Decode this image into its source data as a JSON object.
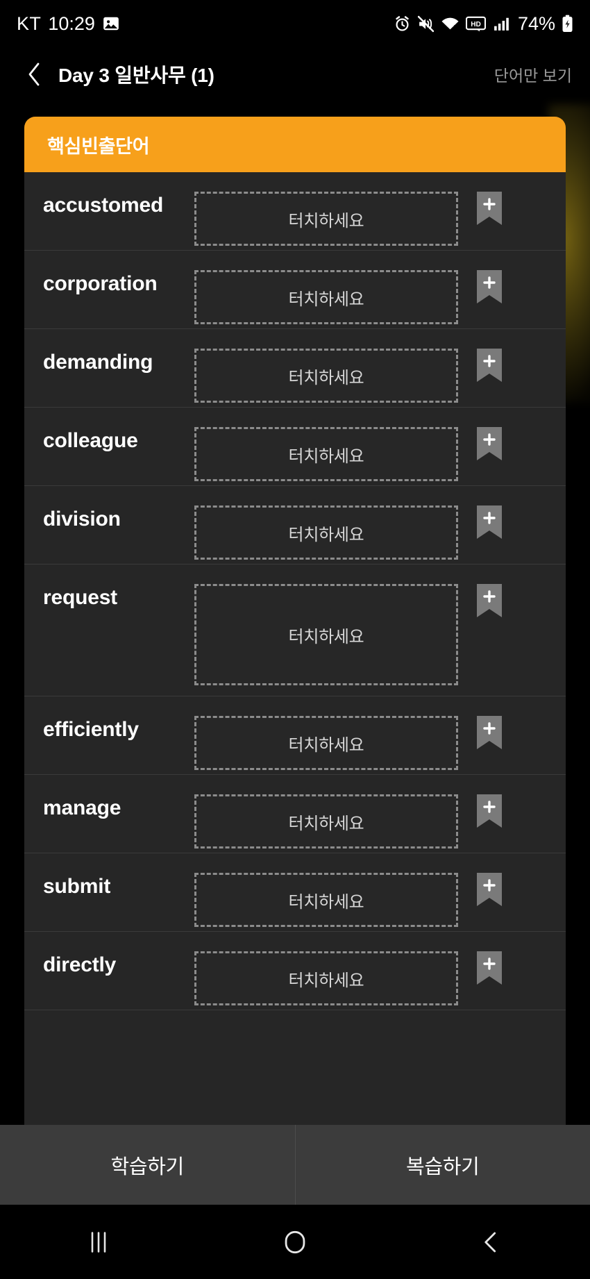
{
  "status_bar": {
    "carrier": "KT",
    "time": "10:29",
    "battery_percent": "74%",
    "icons": {
      "photo": "photo-icon",
      "alarm": "alarm-icon",
      "mute": "volume-mute-icon",
      "wifi": "wifi-icon",
      "hd": "hd-icon",
      "signal": "cellular-signal-icon",
      "battery": "battery-charging-icon"
    }
  },
  "header": {
    "back_label": "back-chevron",
    "title": "Day 3 일반사무 (1)",
    "action": "단어만 보기"
  },
  "card": {
    "banner_title": "핵심빈출단어",
    "banner_color": "#F7A01B",
    "touch_placeholder": "터치하세요",
    "bookmark_label": "+",
    "rows": [
      {
        "word": "accustomed",
        "reveal": "터치하세요",
        "tall": false
      },
      {
        "word": "corporation",
        "reveal": "터치하세요",
        "tall": false
      },
      {
        "word": "demanding",
        "reveal": "터치하세요",
        "tall": false
      },
      {
        "word": "colleague",
        "reveal": "터치하세요",
        "tall": false
      },
      {
        "word": "division",
        "reveal": "터치하세요",
        "tall": false
      },
      {
        "word": "request",
        "reveal": "터치하세요",
        "tall": true
      },
      {
        "word": "efficiently",
        "reveal": "터치하세요",
        "tall": false
      },
      {
        "word": "manage",
        "reveal": "터치하세요",
        "tall": false
      },
      {
        "word": "submit",
        "reveal": "터치하세요",
        "tall": false
      },
      {
        "word": "directly",
        "reveal": "터치하세요",
        "tall": false
      }
    ]
  },
  "bottom_bar": {
    "study_label": "학습하기",
    "review_label": "복습하기"
  },
  "nav_bar": {
    "recents": "recents-icon",
    "home": "home-icon",
    "back": "back-icon"
  }
}
